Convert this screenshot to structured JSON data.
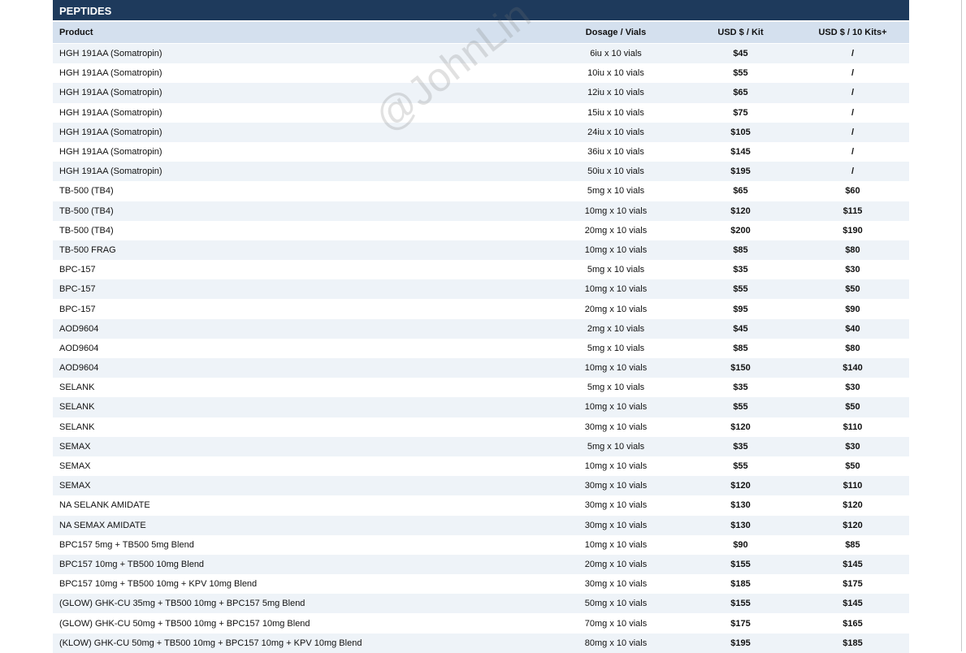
{
  "section": {
    "title": "PEPTIDES"
  },
  "columns": {
    "product": "Product",
    "dosage": "Dosage / Vials",
    "price_kit": "USD $ / Kit",
    "price_10kits": "USD $ / 10 Kits+"
  },
  "rows": [
    {
      "product": "HGH 191AA (Somatropin)",
      "dosage": "6iu x 10 vials",
      "kit": "$45",
      "ten": "/"
    },
    {
      "product": "HGH 191AA (Somatropin)",
      "dosage": "10iu x 10 vials",
      "kit": "$55",
      "ten": "/"
    },
    {
      "product": "HGH 191AA (Somatropin)",
      "dosage": "12iu x 10 vials",
      "kit": "$65",
      "ten": "/"
    },
    {
      "product": "HGH 191AA (Somatropin)",
      "dosage": "15iu x 10 vials",
      "kit": "$75",
      "ten": "/"
    },
    {
      "product": "HGH 191AA (Somatropin)",
      "dosage": "24iu x 10 vials",
      "kit": "$105",
      "ten": "/"
    },
    {
      "product": "HGH 191AA (Somatropin)",
      "dosage": "36iu x 10 vials",
      "kit": "$145",
      "ten": "/"
    },
    {
      "product": "HGH 191AA (Somatropin)",
      "dosage": "50iu x 10 vials",
      "kit": "$195",
      "ten": "/"
    },
    {
      "product": "TB-500 (TB4)",
      "dosage": "5mg x 10 vials",
      "kit": "$65",
      "ten": "$60"
    },
    {
      "product": "TB-500 (TB4)",
      "dosage": "10mg x 10 vials",
      "kit": "$120",
      "ten": "$115"
    },
    {
      "product": "TB-500 (TB4)",
      "dosage": "20mg x 10 vials",
      "kit": "$200",
      "ten": "$190"
    },
    {
      "product": "TB-500 FRAG",
      "dosage": "10mg x 10 vials",
      "kit": "$85",
      "ten": "$80"
    },
    {
      "product": "BPC-157",
      "dosage": "5mg x 10 vials",
      "kit": "$35",
      "ten": "$30"
    },
    {
      "product": "BPC-157",
      "dosage": "10mg x 10 vials",
      "kit": "$55",
      "ten": "$50"
    },
    {
      "product": "BPC-157",
      "dosage": "20mg x 10 vials",
      "kit": "$95",
      "ten": "$90"
    },
    {
      "product": "AOD9604",
      "dosage": "2mg x 10 vials",
      "kit": "$45",
      "ten": "$40"
    },
    {
      "product": "AOD9604",
      "dosage": "5mg x 10 vials",
      "kit": "$85",
      "ten": "$80"
    },
    {
      "product": "AOD9604",
      "dosage": "10mg x 10 vials",
      "kit": "$150",
      "ten": "$140"
    },
    {
      "product": "SELANK",
      "dosage": "5mg x 10 vials",
      "kit": "$35",
      "ten": "$30"
    },
    {
      "product": "SELANK",
      "dosage": "10mg x 10 vials",
      "kit": "$55",
      "ten": "$50"
    },
    {
      "product": "SELANK",
      "dosage": "30mg x 10 vials",
      "kit": "$120",
      "ten": "$110"
    },
    {
      "product": "SEMAX",
      "dosage": "5mg x 10 vials",
      "kit": "$35",
      "ten": "$30"
    },
    {
      "product": "SEMAX",
      "dosage": "10mg x 10 vials",
      "kit": "$55",
      "ten": "$50"
    },
    {
      "product": "SEMAX",
      "dosage": "30mg x 10 vials",
      "kit": "$120",
      "ten": "$110"
    },
    {
      "product": "NA SELANK AMIDATE",
      "dosage": "30mg x 10 vials",
      "kit": "$130",
      "ten": "$120"
    },
    {
      "product": "NA SEMAX AMIDATE",
      "dosage": "30mg x 10 vials",
      "kit": "$130",
      "ten": "$120"
    },
    {
      "product": "BPC157 5mg + TB500 5mg Blend",
      "dosage": "10mg x 10 vials",
      "kit": "$90",
      "ten": "$85"
    },
    {
      "product": "BPC157 10mg + TB500 10mg Blend",
      "dosage": "20mg x 10 vials",
      "kit": "$155",
      "ten": "$145"
    },
    {
      "product": "BPC157 10mg + TB500 10mg + KPV 10mg Blend",
      "dosage": "30mg x 10 vials",
      "kit": "$185",
      "ten": "$175"
    },
    {
      "product": "(GLOW) GHK-CU 35mg + TB500 10mg + BPC157 5mg Blend",
      "dosage": "50mg x 10 vials",
      "kit": "$155",
      "ten": "$145"
    },
    {
      "product": "(GLOW) GHK-CU 50mg + TB500 10mg + BPC157 10mg Blend",
      "dosage": "70mg x 10 vials",
      "kit": "$175",
      "ten": "$165"
    },
    {
      "product": "(KLOW) GHK-CU 50mg + TB500 10mg + BPC157 10mg + KPV 10mg Blend",
      "dosage": "80mg x 10 vials",
      "kit": "$195",
      "ten": "$185"
    }
  ],
  "watermark": {
    "text": "@JohnLin"
  },
  "colors": {
    "header_bg": "#1e3a5c",
    "column_header_bg": "#d4e0ee",
    "row_alt_bg": "#eef3f8"
  }
}
